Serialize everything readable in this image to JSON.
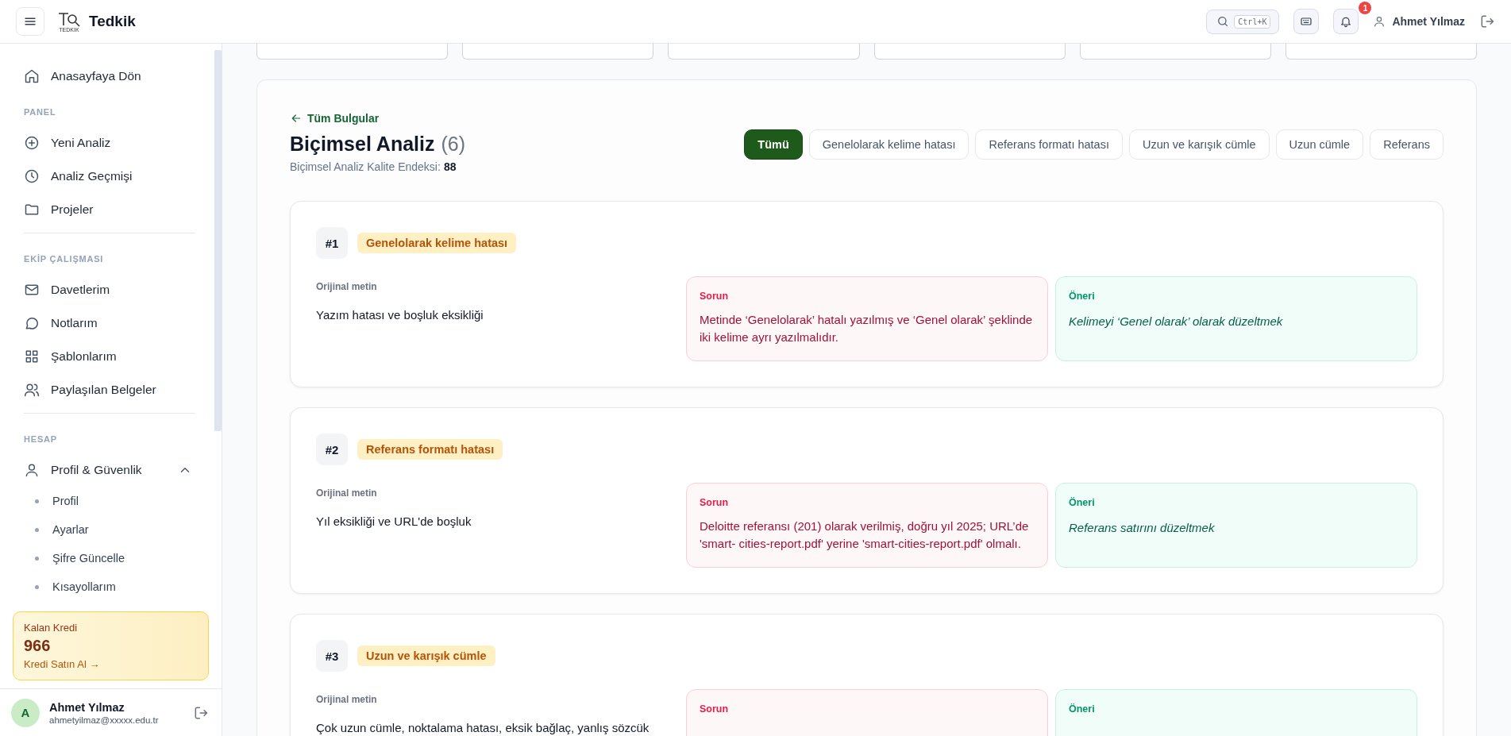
{
  "header": {
    "logo_text": "Tedkik",
    "logo_caption": "TEDKIK",
    "search_shortcut": "Ctrl+K",
    "notification_count": "1",
    "user_name": "Ahmet Yılmaz"
  },
  "sidebar": {
    "home": {
      "label": "Anasayfaya Dön"
    },
    "sections": [
      {
        "title": "PANEL",
        "items": [
          {
            "label": "Yeni Analiz"
          },
          {
            "label": "Analiz Geçmişi"
          },
          {
            "label": "Projeler"
          }
        ]
      },
      {
        "title": "EKİP ÇALIŞMASI",
        "items": [
          {
            "label": "Davetlerim"
          },
          {
            "label": "Notlarım"
          },
          {
            "label": "Şablonlarım"
          },
          {
            "label": "Paylaşılan Belgeler"
          }
        ]
      },
      {
        "title": "HESAP",
        "items": [
          {
            "label": "Profil & Güvenlik",
            "expanded": true,
            "children": [
              {
                "label": "Profil"
              },
              {
                "label": "Ayarlar"
              },
              {
                "label": "Şifre Güncelle"
              },
              {
                "label": "Kısayollarım"
              }
            ]
          }
        ]
      }
    ],
    "credit": {
      "label": "Kalan Kredi",
      "value": "966",
      "link": "Kredi Satın Al →"
    },
    "user": {
      "initial": "A",
      "name": "Ahmet Yılmaz",
      "email": "ahmetyilmaz@xxxxx.edu.tr"
    }
  },
  "main": {
    "back_link": "Tüm Bulgular",
    "title": "Biçimsel Analiz",
    "count": "(6)",
    "index_label": "Biçimsel Analiz Kalite Endeksi:",
    "index_value": "88",
    "filters": [
      {
        "label": "Tümü",
        "selected": true
      },
      {
        "label": "Genelolarak kelime hatası",
        "selected": false
      },
      {
        "label": "Referans formatı hatası",
        "selected": false
      },
      {
        "label": "Uzun ve karışık cümle",
        "selected": false
      },
      {
        "label": "Uzun cümle",
        "selected": false
      },
      {
        "label": "Referans",
        "selected": false
      }
    ],
    "findings": [
      {
        "number": "#1",
        "category": "Genelolarak kelime hatası",
        "original_label": "Orijinal metin",
        "original": "Yazım hatası ve boşluk eksikliği",
        "problem_label": "Sorun",
        "problem": "Metinde ‘Genelolarak’ hatalı yazılmış ve ‘Genel olarak’ şeklinde iki kelime ayrı yazılmalıdır.",
        "suggestion_label": "Öneri",
        "suggestion": "Kelimeyi ‘Genel olarak’ olarak düzeltmek"
      },
      {
        "number": "#2",
        "category": "Referans formatı hatası",
        "original_label": "Orijinal metin",
        "original": "Yıl eksikliği ve URL'de boşluk",
        "problem_label": "Sorun",
        "problem": "Deloitte referansı (201) olarak verilmiş, doğru yıl 2025; URL’de 'smart- cities-report.pdf' yerine 'smart-cities-report.pdf' olmalı.",
        "suggestion_label": "Öneri",
        "suggestion": "Referans satırını düzeltmek"
      },
      {
        "number": "#3",
        "category": "Uzun ve karışık cümle",
        "original_label": "Orijinal metin",
        "original": "Çok uzun cümle, noktalama hatası, eksik bağlaç, yanlış sözcük",
        "problem_label": "Sorun",
        "suggestion_label": "Öneri"
      }
    ]
  }
}
